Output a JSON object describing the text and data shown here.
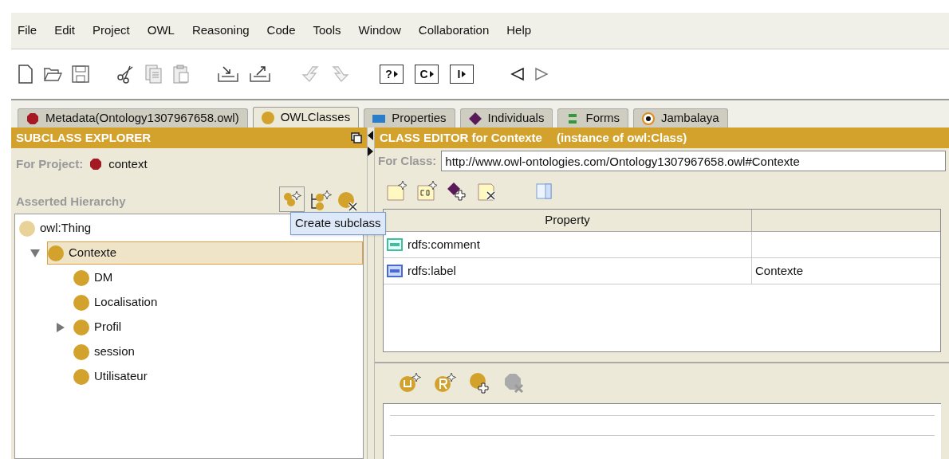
{
  "menu": [
    "File",
    "Edit",
    "Project",
    "OWL",
    "Reasoning",
    "Code",
    "Tools",
    "Window",
    "Collaboration",
    "Help"
  ],
  "toolbar": {
    "query_buttons": [
      "?",
      "C",
      "I"
    ]
  },
  "tabs": [
    {
      "label": "Metadata(Ontology1307967658.owl)",
      "kind": "metadata",
      "selected": false
    },
    {
      "label": "OWLClasses",
      "kind": "classes",
      "selected": true
    },
    {
      "label": "Properties",
      "kind": "properties",
      "selected": false
    },
    {
      "label": "Individuals",
      "kind": "individuals",
      "selected": false
    },
    {
      "label": "Forms",
      "kind": "forms",
      "selected": false
    },
    {
      "label": "Jambalaya",
      "kind": "jambalaya",
      "selected": false
    }
  ],
  "subclass_explorer": {
    "title": "SUBCLASS EXPLORER",
    "project_label": "For Project:",
    "project": "context",
    "hierarchy_label": "Asserted Hierarchy",
    "tooltip": "Create subclass",
    "tree": [
      {
        "label": "owl:Thing",
        "kind": "root",
        "selected": false,
        "children": [
          {
            "label": "Contexte",
            "kind": "branch",
            "expanded": true,
            "selected": true,
            "children": [
              {
                "label": "DM",
                "kind": "leaf",
                "selected": false
              },
              {
                "label": "Localisation",
                "kind": "leaf",
                "selected": false
              },
              {
                "label": "Profil",
                "kind": "branch",
                "expanded": false,
                "selected": false
              },
              {
                "label": "session",
                "kind": "leaf",
                "selected": false
              },
              {
                "label": "Utilisateur",
                "kind": "leaf",
                "selected": false
              }
            ]
          }
        ]
      }
    ]
  },
  "class_editor": {
    "title": "CLASS EDITOR for Contexte",
    "subtitle": "(instance of owl:Class)",
    "for_class_label": "For Class:",
    "for_class": "http://www.owl-ontologies.com/Ontology1307967658.owl#Contexte",
    "table": {
      "columns": [
        "Property",
        ""
      ],
      "rows": [
        {
          "property": "rdfs:comment",
          "kind": "comment",
          "value": ""
        },
        {
          "property": "rdfs:label",
          "kind": "label",
          "value": "Contexte"
        }
      ]
    }
  }
}
